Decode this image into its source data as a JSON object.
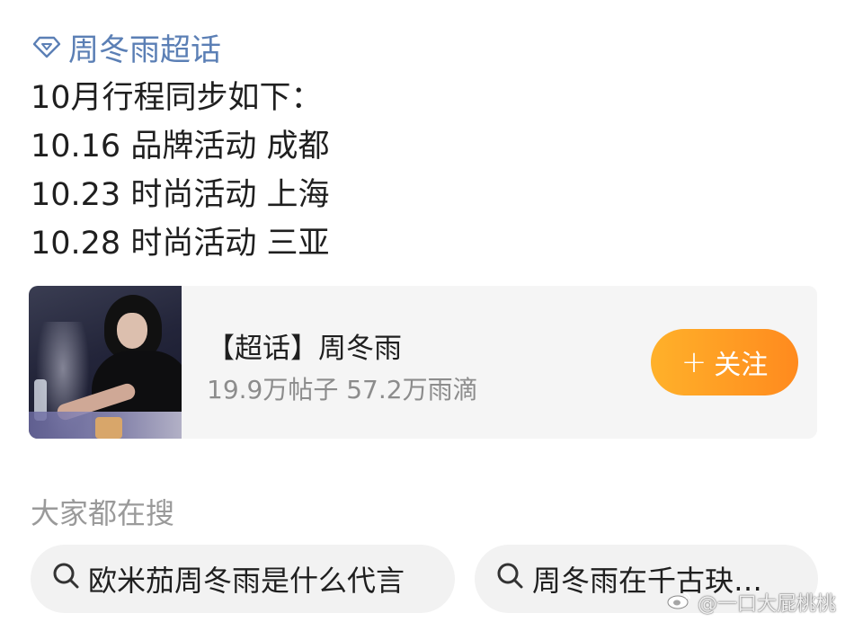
{
  "tag": {
    "icon": "diamond-icon",
    "label": "周冬雨超话",
    "color": "#5B7FB5"
  },
  "post": {
    "lines": [
      "10月行程同步如下：",
      "10.16 品牌活动 成都",
      "10.23 时尚活动 上海",
      "10.28 时尚活动 三亚"
    ]
  },
  "topic_card": {
    "title": "【超话】周冬雨",
    "stats": "19.9万帖子 57.2万雨滴",
    "follow_label": "关注",
    "follow_icon": "plus-icon",
    "accent_color": "#FF9A24"
  },
  "search": {
    "section_title": "大家都在搜",
    "chips": [
      {
        "icon": "search-icon",
        "label": "欧米茄周冬雨是什么代言"
      },
      {
        "icon": "search-icon",
        "label": "周冬雨在千古玦…"
      }
    ]
  },
  "watermark": {
    "icon": "weibo-logo-icon",
    "text": "@一口大屁桃桃"
  }
}
